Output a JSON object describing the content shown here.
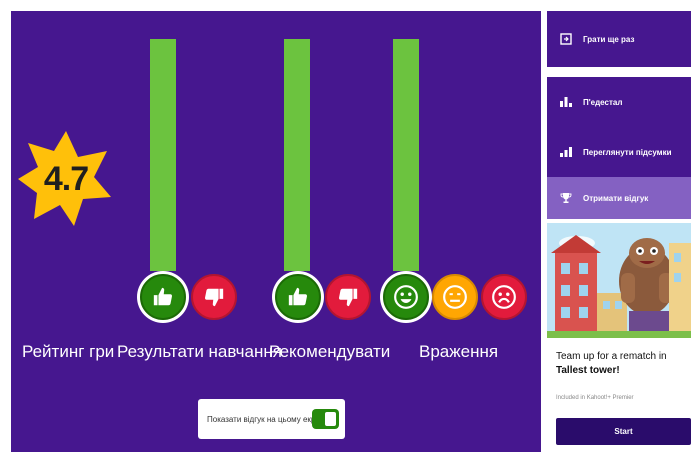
{
  "rating": {
    "value": "4.7",
    "label": "Рейтинг гри"
  },
  "colors": {
    "background": "#46178f",
    "bar": "#6cc33f",
    "like": "#26890c",
    "dislike": "#e21b3c",
    "neutral": "#ffa602",
    "star": "#ffc00a"
  },
  "categories": [
    {
      "label": "Результати навчання",
      "icons": [
        "thumbs-up-icon",
        "thumbs-down-icon"
      ],
      "level": 1.0
    },
    {
      "label": "Рекомендувати",
      "icons": [
        "thumbs-up-icon",
        "thumbs-down-icon"
      ],
      "level": 1.0
    },
    {
      "label": "Враження",
      "icons": [
        "smile-icon",
        "neutral-face-icon",
        "sad-face-icon"
      ],
      "level": 1.0
    }
  ],
  "toggle": {
    "label": "Показати відгук на цьому екрані",
    "on": true
  },
  "sidebar": {
    "items": [
      {
        "label": "Грати ще раз",
        "icon": "replay-icon"
      },
      {
        "label": "П'едестал",
        "icon": "podium-icon"
      },
      {
        "label": "Переглянути підсумки",
        "icon": "bar-chart-icon"
      },
      {
        "label": "Отримати відгук",
        "icon": "trophy-icon"
      }
    ]
  },
  "promo": {
    "title_prefix": "Team up for a rematch in",
    "title_game": "Tallest tower!",
    "subtitle": "Included in Kahoot!+ Premier",
    "button": "Start"
  }
}
